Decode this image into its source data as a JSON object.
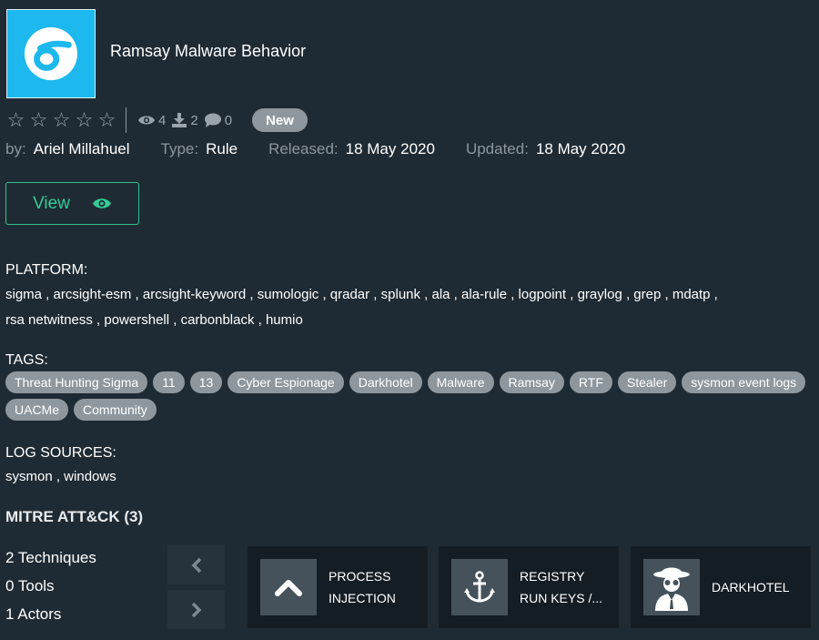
{
  "header": {
    "title": "Ramsay Malware Behavior",
    "logo_icon": "sigma-logo-icon",
    "logo_color": "#1cb8ee"
  },
  "stats": {
    "rating": 0,
    "rating_max": 5,
    "views": "4",
    "downloads": "2",
    "comments": "0",
    "badge": "New"
  },
  "meta": {
    "by_label": "by:",
    "author": "Ariel Millahuel",
    "type_label": "Type:",
    "type": "Rule",
    "released_label": "Released:",
    "released": "18 May 2020",
    "updated_label": "Updated:",
    "updated": "18 May 2020"
  },
  "view_button": {
    "label": "View",
    "icon": "eye-icon",
    "color": "#33cc96"
  },
  "platform": {
    "label": "PLATFORM:",
    "line1": "sigma , arcsight-esm , arcsight-keyword , sumologic , qradar , splunk , ala , ala-rule , logpoint , graylog , grep , mdatp ,",
    "line2": "rsa netwitness , powershell , carbonblack , humio"
  },
  "tags": {
    "label": "TAGS:",
    "items": [
      "Threat Hunting Sigma",
      "11",
      "13",
      "Cyber Espionage",
      "Darkhotel",
      "Malware",
      "Ramsay",
      "RTF",
      "Stealer",
      "sysmon event logs",
      "UACMe",
      "Community"
    ]
  },
  "log_sources": {
    "label": "LOG SOURCES:",
    "text": "sysmon , windows"
  },
  "mitre": {
    "title": "MITRE ATT&CK (3)",
    "techniques": "2 Techniques",
    "tools": "0 Tools",
    "actors": "1 Actors",
    "cards": [
      {
        "line1": "PROCESS",
        "line2": "INJECTION",
        "icon": "chevron-up-icon"
      },
      {
        "line1": "REGISTRY",
        "line2": "RUN KEYS /...",
        "icon": "anchor-icon"
      },
      {
        "line1": "DARKHOTEL",
        "line2": "",
        "icon": "spy-icon"
      }
    ]
  }
}
